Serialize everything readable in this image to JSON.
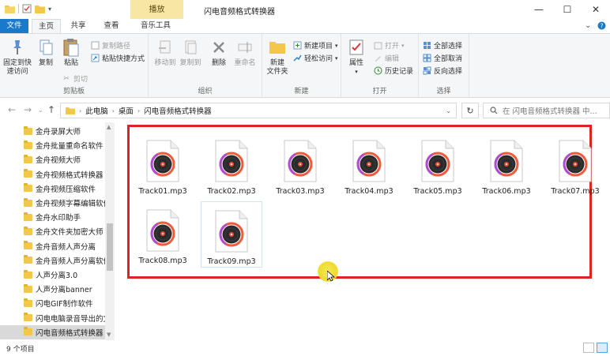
{
  "window": {
    "title": "闪电音频格式转换器",
    "context_tab": "播放",
    "minimize_glyph": "—",
    "maximize_glyph": "☐",
    "close_glyph": "✕"
  },
  "tabs": {
    "file": "文件",
    "home": "主页",
    "share": "共享",
    "view": "查看",
    "music_tools": "音乐工具"
  },
  "ribbon": {
    "clipboard": {
      "label": "剪贴板",
      "pin": "固定到快\n速访问",
      "copy": "复制",
      "paste": "粘贴",
      "copy_path": "复制路径",
      "paste_shortcut": "粘贴快捷方式",
      "cut": "剪切"
    },
    "organize": {
      "label": "组织",
      "move_to": "移动到",
      "copy_to": "复制到",
      "delete": "删除",
      "rename": "重命名"
    },
    "new": {
      "label": "新建",
      "new_folder": "新建\n文件夹",
      "new_item": "新建项目",
      "easy_access": "轻松访问"
    },
    "open": {
      "label": "打开",
      "properties": "属性",
      "open": "打开",
      "edit": "编辑",
      "history": "历史记录"
    },
    "select": {
      "label": "选择",
      "select_all": "全部选择",
      "select_none": "全部取消",
      "invert": "反向选择"
    }
  },
  "address": {
    "crumbs": [
      "此电脑",
      "桌面",
      "闪电音频格式转换器"
    ],
    "search_placeholder": "在 闪电音频格式转换器 中..."
  },
  "nav": {
    "items": [
      "金舟录屏大师",
      "金舟批量重命名软件",
      "金舟视频大师",
      "金舟视频格式转换器",
      "金舟视频压缩软件",
      "金舟视频字幕编辑软件",
      "金舟水印助手",
      "金舟文件夹加密大师",
      "金舟音频人声分离",
      "金舟音频人声分离软件",
      "人声分离3.0",
      "人声分离banner",
      "闪电GIF制作软件",
      "闪电电脑录音导出的文",
      "闪电音频格式转换器"
    ],
    "selected_index": 14
  },
  "files": [
    "Track01.mp3",
    "Track02.mp3",
    "Track03.mp3",
    "Track04.mp3",
    "Track05.mp3",
    "Track06.mp3",
    "Track07.mp3",
    "Track08.mp3",
    "Track09.mp3"
  ],
  "status": {
    "count": "9 个项目"
  },
  "icons": {
    "file": "mp3-file-icon",
    "folder": "folder-icon",
    "search": "search-icon",
    "refresh": "refresh-icon"
  },
  "colors": {
    "file_tab": "#1979ca",
    "context_tab": "#f7e6a4",
    "highlight_border": "#e02222",
    "folder": "#f3c84a"
  }
}
